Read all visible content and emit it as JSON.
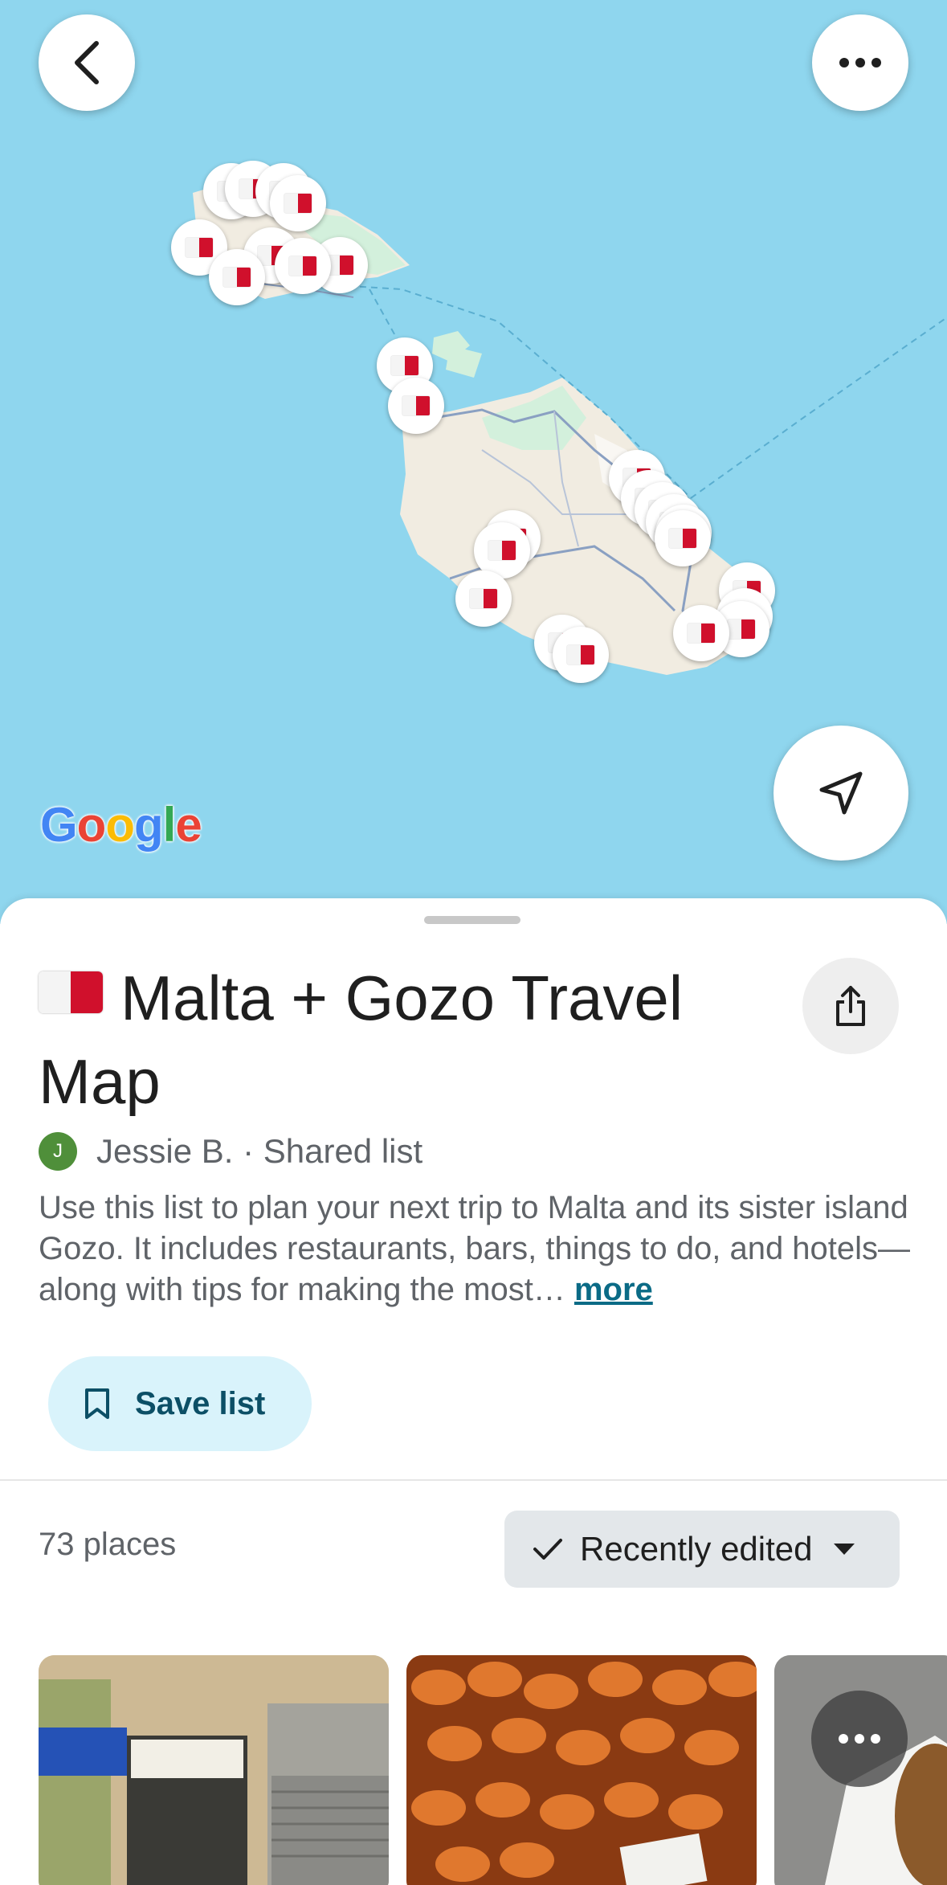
{
  "map": {
    "logo_text": "Google",
    "colors": {
      "water": "#8fd6ee",
      "land": "#f1ece1",
      "park": "#d3f0dc",
      "road": "#8aa0c2",
      "ferry": "#5aaed0"
    },
    "icons": {
      "back": "chevron-left-icon",
      "more": "ellipsis-icon",
      "locate": "navigation-arrow-icon",
      "pin": "malta-flag-icon"
    }
  },
  "list": {
    "title": "Malta + Gozo Travel Map",
    "title_emoji": "malta-flag",
    "owner_initial": "J",
    "owner_text": "Jessie B. · Shared list",
    "description": "Use this list to plan your next trip to Malta and its sister island Gozo. It includes restaurants, bars, things to do, and hotels—along with tips for making the most… ",
    "more_link": "more",
    "save_label": "Save list",
    "places_count": "73 places",
    "sort_label": "Recently edited"
  },
  "colors": {
    "accent_text": "#0b6b86",
    "save_bg": "#d9f3fb",
    "avatar": "#4f8f3a"
  }
}
